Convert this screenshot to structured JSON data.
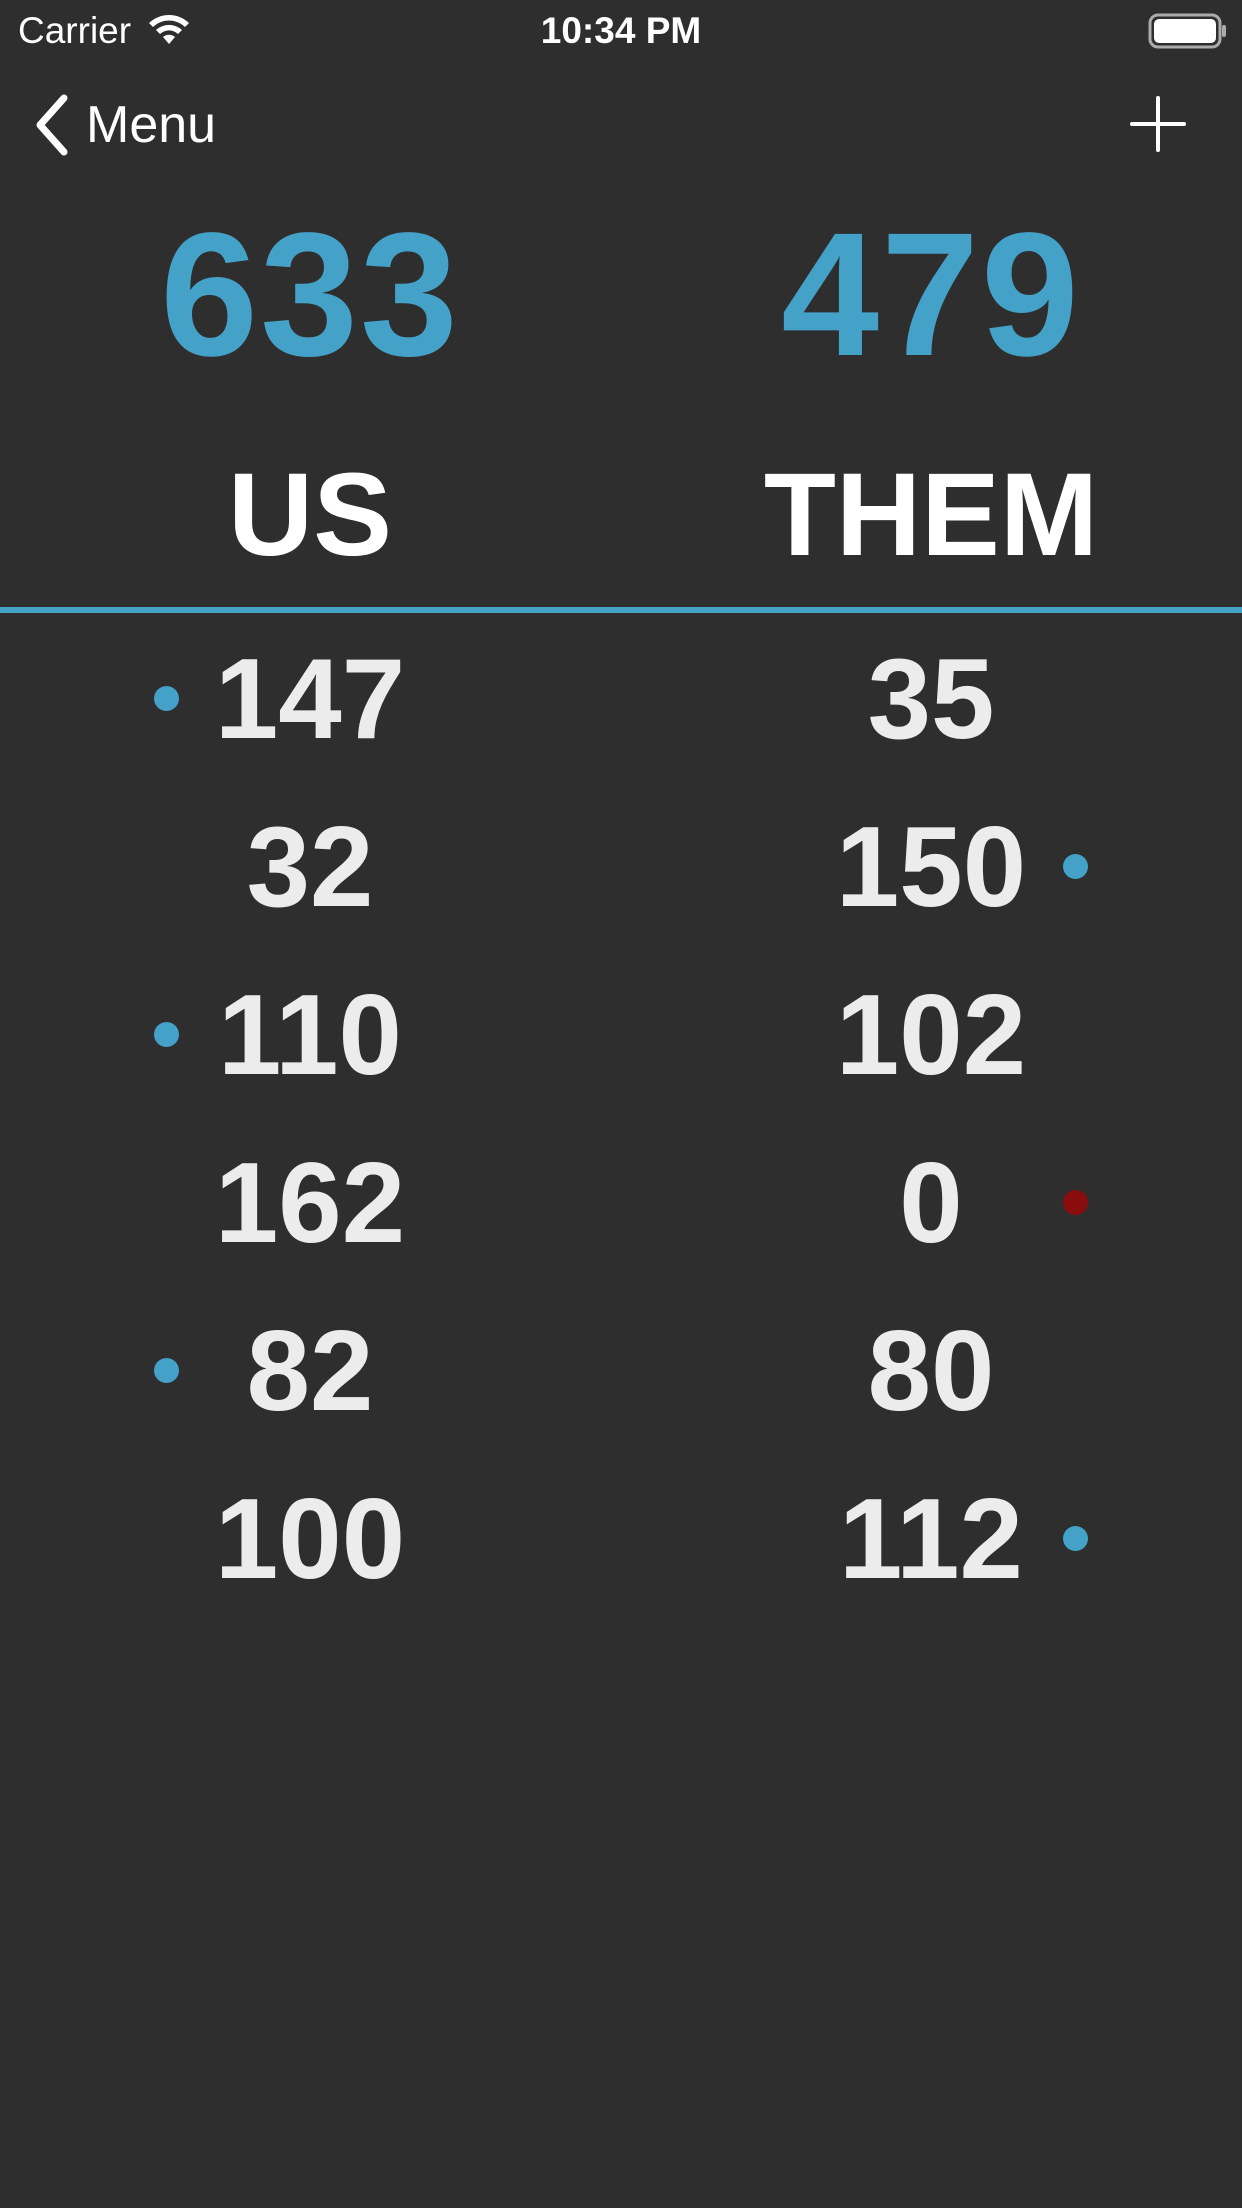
{
  "status_bar": {
    "carrier": "Carrier",
    "time": "10:34 PM"
  },
  "nav": {
    "back_label": "Menu",
    "add_icon": "plus-icon",
    "back_icon": "chevron-left-icon"
  },
  "teams": {
    "us": {
      "name": "US",
      "total": "633"
    },
    "them": {
      "name": "THEM",
      "total": "479"
    }
  },
  "colors": {
    "accent": "#44a1c8",
    "background": "#2e2e2e",
    "loss_marker": "#8a0d0d",
    "text": "#ececec"
  },
  "rounds": [
    {
      "us": "147",
      "them": "35",
      "marker": "us",
      "marker_type": "win"
    },
    {
      "us": "32",
      "them": "150",
      "marker": "them",
      "marker_type": "win"
    },
    {
      "us": "110",
      "them": "102",
      "marker": "us",
      "marker_type": "win"
    },
    {
      "us": "162",
      "them": "0",
      "marker": "them",
      "marker_type": "loss"
    },
    {
      "us": "82",
      "them": "80",
      "marker": "us",
      "marker_type": "win"
    },
    {
      "us": "100",
      "them": "112",
      "marker": "them",
      "marker_type": "win"
    }
  ]
}
